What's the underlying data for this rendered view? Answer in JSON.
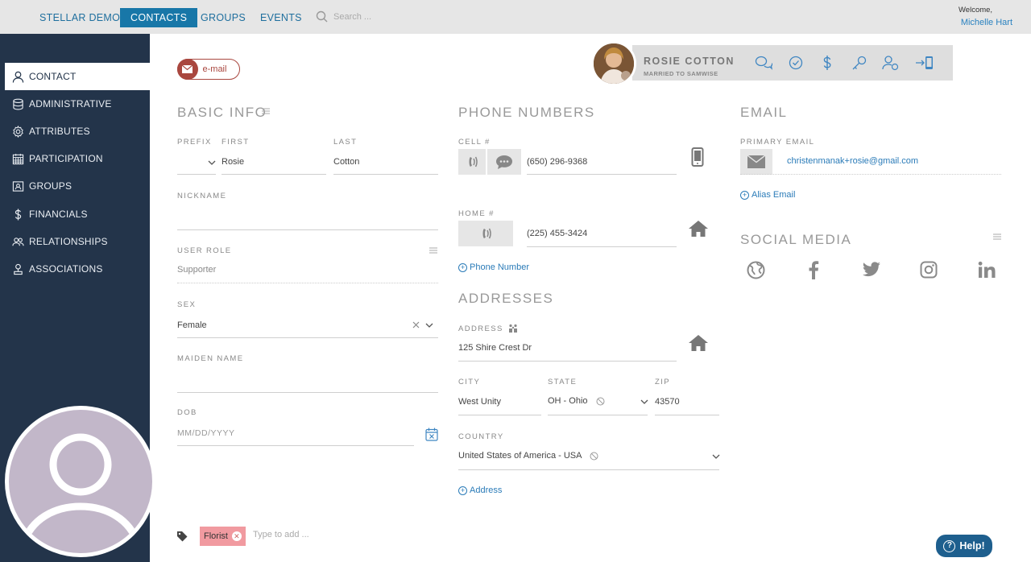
{
  "topnav": {
    "items": [
      {
        "label": "STELLAR DEMO",
        "active": false
      },
      {
        "label": "CONTACTS",
        "active": true
      },
      {
        "label": "GROUPS",
        "active": false
      },
      {
        "label": "EVENTS",
        "active": false
      }
    ],
    "search_placeholder": "Search ...",
    "welcome": "Welcome,",
    "user_name": "Michelle Hart"
  },
  "sidebar": {
    "items": [
      {
        "label": "CONTACT",
        "icon": "person-icon",
        "active": true
      },
      {
        "label": "ADMINISTRATIVE",
        "icon": "database-icon",
        "active": false
      },
      {
        "label": "ATTRIBUTES",
        "icon": "gear-icon",
        "active": false
      },
      {
        "label": "PARTICIPATION",
        "icon": "calendar-icon",
        "active": false
      },
      {
        "label": "GROUPS",
        "icon": "group-icon",
        "active": false
      },
      {
        "label": "FINANCIALS",
        "icon": "dollar-icon",
        "active": false
      },
      {
        "label": "RELATIONSHIPS",
        "icon": "people-icon",
        "active": false
      },
      {
        "label": "ASSOCIATIONS",
        "icon": "association-icon",
        "active": false
      }
    ]
  },
  "email_button": {
    "label": "e-mail"
  },
  "contact_card": {
    "name": "ROSIE COTTON",
    "subtitle": "MARRIED TO SAMWISE",
    "actions": [
      "chat-icon",
      "check-circle-icon",
      "dollar-icon",
      "key-icon",
      "user-settings-icon",
      "mobile-login-icon"
    ]
  },
  "basic_info": {
    "title": "BASIC INFO",
    "prefix_label": "PREFIX",
    "prefix_value": "",
    "first_label": "FIRST",
    "first_value": "Rosie",
    "last_label": "LAST",
    "last_value": "Cotton",
    "nickname_label": "NICKNAME",
    "nickname_value": "",
    "user_role_label": "USER ROLE",
    "user_role_value": "Supporter",
    "sex_label": "SEX",
    "sex_value": "Female",
    "maiden_label": "MAIDEN NAME",
    "maiden_value": "",
    "dob_label": "DOB",
    "dob_placeholder": "MM/DD/YYYY"
  },
  "phone_numbers": {
    "title": "PHONE NUMBERS",
    "cell_label": "CELL #",
    "cell_value": "(650) 296-9368",
    "home_label": "HOME #",
    "home_value": "(225) 455-3424",
    "add_label": "Phone Number"
  },
  "addresses": {
    "title": "ADDRESSES",
    "address_label": "ADDRESS",
    "address_value": "125 Shire Crest Dr",
    "city_label": "CITY",
    "city_value": "West Unity",
    "state_label": "STATE",
    "state_value": "OH - Ohio",
    "zip_label": "ZIP",
    "zip_value": "43570",
    "country_label": "COUNTRY",
    "country_value": "United States of America - USA",
    "add_label": "Address"
  },
  "email": {
    "title": "EMAIL",
    "primary_label": "PRIMARY EMAIL",
    "primary_value": "christenmanak+rosie@gmail.com",
    "alias_label": "Alias Email"
  },
  "social_media": {
    "title": "SOCIAL MEDIA",
    "icons": [
      "globe-icon",
      "facebook-icon",
      "twitter-icon",
      "instagram-icon",
      "linkedin-icon"
    ]
  },
  "tags": {
    "items": [
      "Florist"
    ],
    "placeholder": "Type to add ..."
  },
  "help": {
    "label": "Help!"
  },
  "colors": {
    "sidebar_bg": "#23344a",
    "accent": "#1877a8",
    "email_red": "#a9473f",
    "tag_pink": "#f19aa0",
    "help_bg": "#1e5f8e"
  }
}
